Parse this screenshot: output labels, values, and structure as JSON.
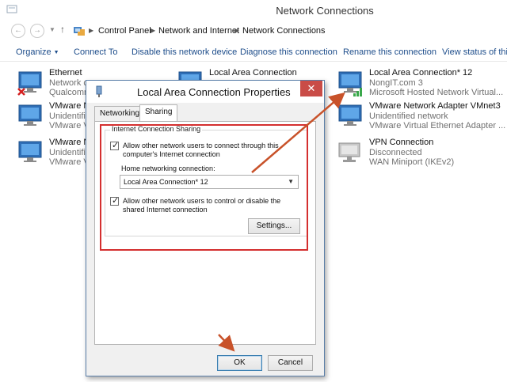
{
  "window": {
    "title": "Network Connections"
  },
  "breadcrumb": [
    "Control Panel",
    "Network and Internet",
    "Network Connections"
  ],
  "commands": {
    "organize": "Organize",
    "connect_to": "Connect To",
    "disable": "Disable this network device",
    "diagnose": "Diagnose this connection",
    "rename": "Rename this connection",
    "view_status": "View status of this"
  },
  "connections": [
    {
      "name": "Ethernet",
      "status": "Network ca",
      "device": "Qualcomm",
      "icon": "wired-disconnected-icon"
    },
    {
      "name": "VMware Ne",
      "status": "Unidentifie",
      "device": "VMware Vir",
      "icon": "wired-network-icon"
    },
    {
      "name": "VMware Ne",
      "status": "Unidentifie",
      "device": "VMware Vir",
      "icon": "wired-network-icon"
    },
    {
      "name": "Local Area Connection",
      "status": "",
      "device": "",
      "icon": "wired-network-icon"
    },
    {
      "name": "Local Area Connection* 12",
      "status": "NongIT.com  3",
      "device": "Microsoft Hosted Network Virtual...",
      "icon": "wireless-signal-icon"
    },
    {
      "name": "VMware Network Adapter VMnet3",
      "status": "Unidentified network",
      "device": "VMware Virtual Ethernet Adapter ...",
      "icon": "wired-network-icon"
    },
    {
      "name": "VPN Connection",
      "status": "Disconnected",
      "device": "WAN Miniport (IKEv2)",
      "icon": "vpn-icon"
    }
  ],
  "dialog": {
    "title": "Local Area Connection Properties",
    "close": "✕",
    "tabs": [
      "Networking",
      "Sharing"
    ],
    "group_title": "Internet Connection Sharing",
    "allow_connect": "Allow other network users to connect through this computer's Internet connection",
    "home_label": "Home networking connection:",
    "home_value": "Local Area Connection* 12",
    "allow_control": "Allow other network users to control or disable the shared Internet connection",
    "settings": "Settings...",
    "ok": "OK",
    "cancel": "Cancel"
  },
  "colors": {
    "annotation": "#d42f2f",
    "arrow": "#c8522a",
    "link": "#1c4c8a"
  }
}
